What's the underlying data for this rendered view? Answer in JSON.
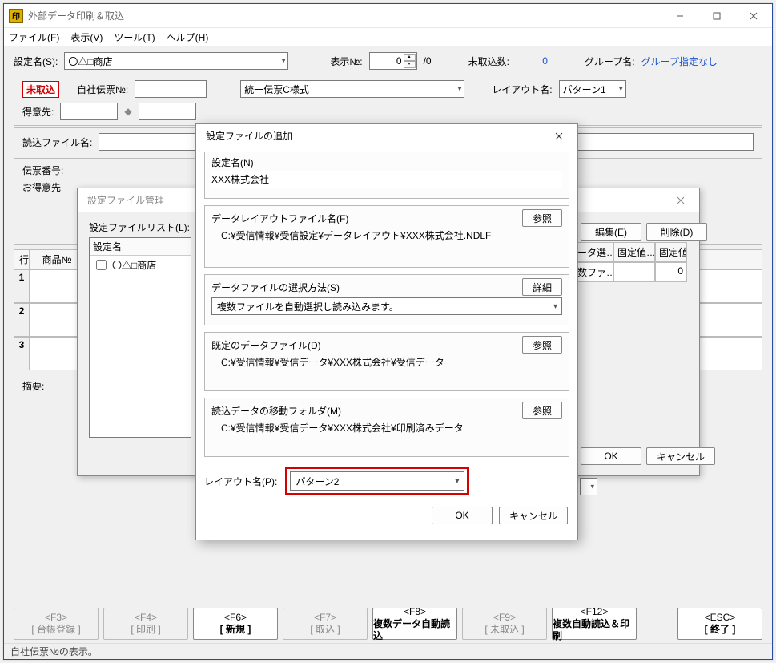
{
  "window": {
    "title": "外部データ印刷＆取込",
    "icon_text": "印"
  },
  "menu": {
    "file": "ファイル(F)",
    "view": "表示(V)",
    "tool": "ツール(T)",
    "help": "ヘルプ(H)"
  },
  "toolbar": {
    "setting_name_lbl": "設定名(S):",
    "setting_name_val": "〇△□商店",
    "display_no_lbl": "表示№:",
    "display_no_val": "0",
    "display_no_total": "/0",
    "unimported_lbl": "未取込数:",
    "unimported_val": "0",
    "group_lbl": "グループ名:",
    "group_val": "グループ指定なし"
  },
  "header_panel": {
    "stamp": "未取込",
    "own_slip_lbl": "自社伝票№:",
    "format_val": "統一伝票C様式",
    "layout_lbl": "レイアウト名:",
    "layout_val": "パターン1",
    "customer_lbl": "得意先:",
    "diamond": "◆",
    "readfile_lbl": "読込ファイル名:",
    "slipno_lbl": "伝票番号:",
    "cust2_lbl": "お得意先"
  },
  "grid": {
    "row_lbl": "行",
    "col1": "商品№",
    "rows": [
      "1",
      "2",
      "3"
    ]
  },
  "summary_lbl": "摘要:",
  "fkeys": {
    "f3a": "<F3>",
    "f3b": "[ 台帳登録 ]",
    "f4a": "<F4>",
    "f4b": "[ 印刷 ]",
    "f6a": "<F6>",
    "f6b": "[ 新規 ]",
    "f7a": "<F7>",
    "f7b": "[ 取込 ]",
    "f8a": "<F8>",
    "f8b": "複数データ自動読込",
    "f9a": "<F9>",
    "f9b": "[ 未取込 ]",
    "f12a": "<F12>",
    "f12b": "複数自動読込＆印刷",
    "esca": "<ESC>",
    "escb": "[ 終了 ]"
  },
  "status": "自社伝票№の表示。",
  "dlg1": {
    "title": "設定ファイル管理",
    "list_lbl": "設定ファイルリスト(L):",
    "list_head": "設定名",
    "list_item1": "〇△□商店",
    "edit": "編集(E)",
    "delete": "削除(D)",
    "cols": {
      "c1": "ータ選…",
      "c2": "固定値…",
      "c3": "固定値"
    },
    "row1": "数ファ…",
    "row1c": "0",
    "ok": "OK",
    "cancel": "キャンセル"
  },
  "dlg2": {
    "title": "設定ファイルの追加",
    "setting_name_lbl": "設定名(N)",
    "setting_name_val": "XXX株式会社",
    "layoutfile_lbl": "データレイアウトファイル名(F)",
    "layoutfile_val": "C:¥受信情報¥受信設定¥データレイアウト¥XXX株式会社.NDLF",
    "browse": "参照",
    "datafile_method_lbl": "データファイルの選択方法(S)",
    "datafile_method_val": "複数ファイルを自動選択し読み込みます。",
    "detail": "詳細",
    "default_data_lbl": "既定のデータファイル(D)",
    "default_data_val": "C:¥受信情報¥受信データ¥XXX株式会社¥受信データ",
    "movefolder_lbl": "読込データの移動フォルダ(M)",
    "movefolder_val": "C:¥受信情報¥受信データ¥XXX株式会社¥印刷済みデータ",
    "layout_lbl": "レイアウト名(P):",
    "layout_val": "パターン2",
    "ok": "OK",
    "cancel": "キャンセル"
  }
}
